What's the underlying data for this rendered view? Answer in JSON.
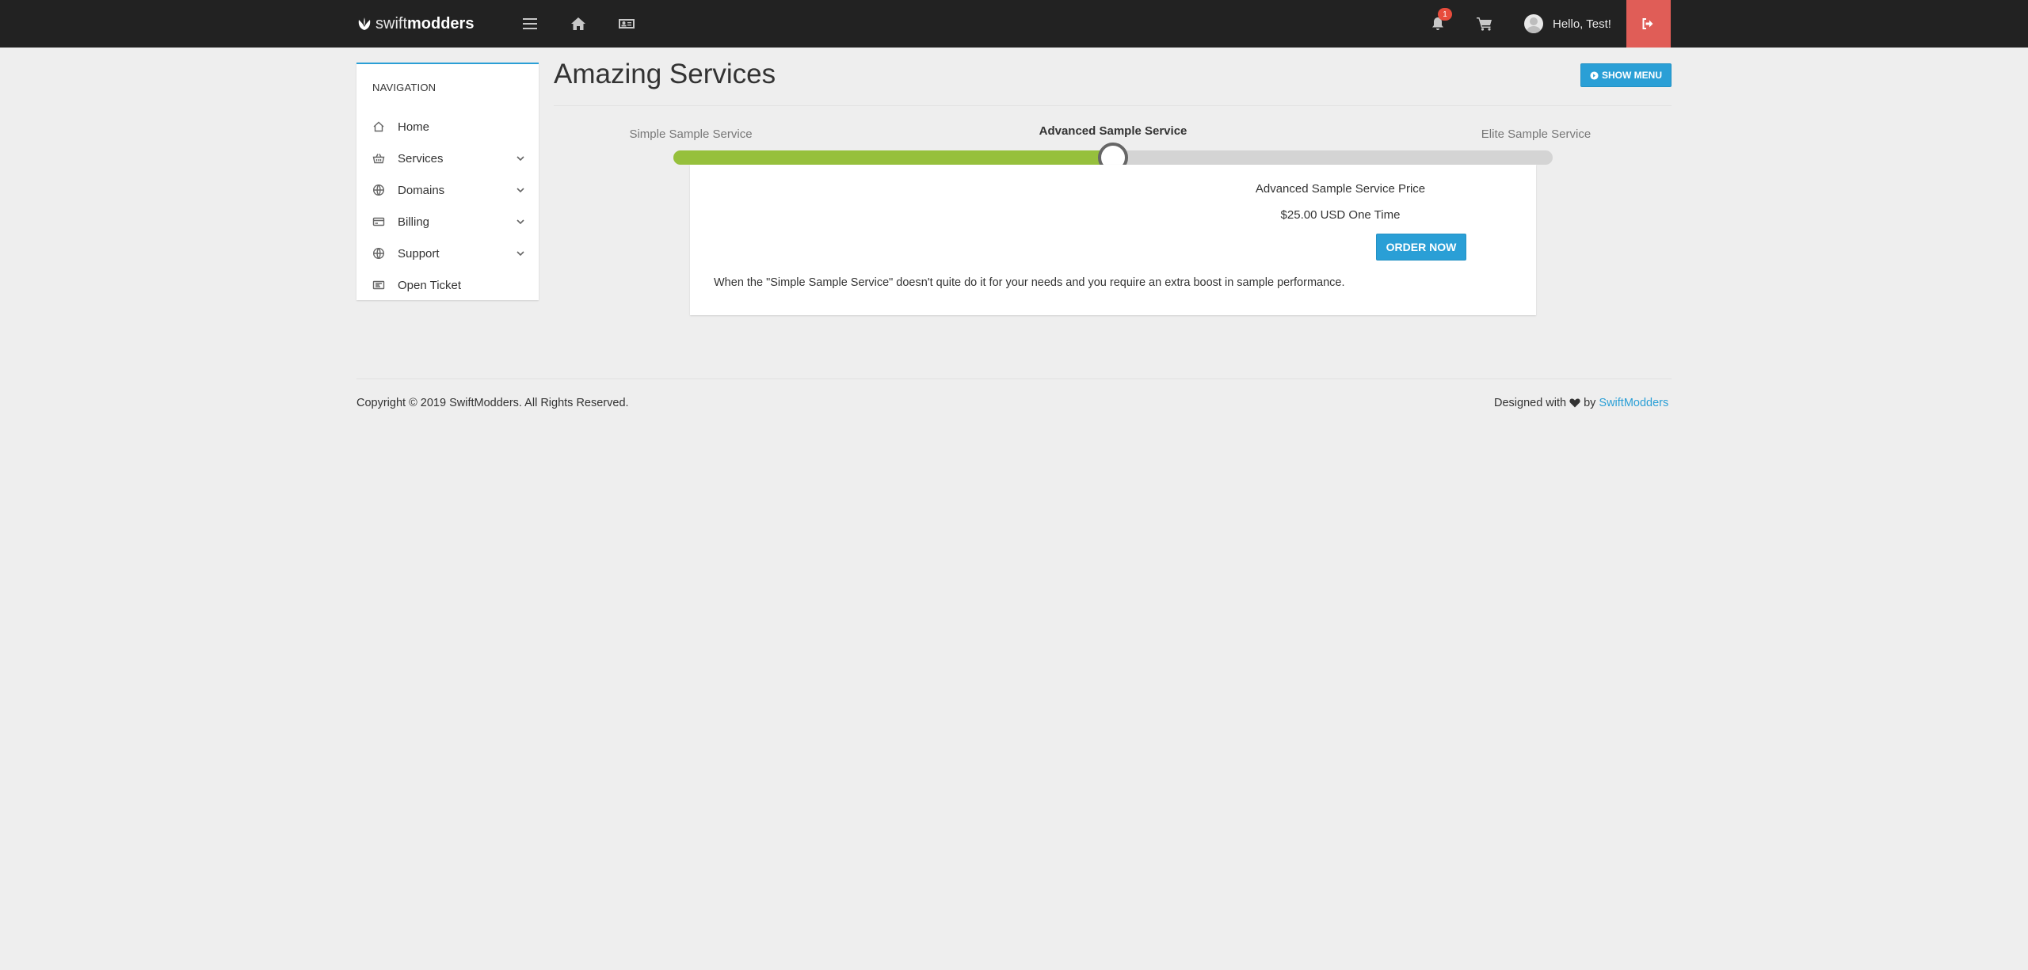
{
  "topbar": {
    "brand_light": "swift",
    "brand_bold": "modders",
    "notification_count": "1",
    "user_greeting": "Hello, Test!"
  },
  "sidebar": {
    "title": "NAVIGATION",
    "items": [
      {
        "label": "Home",
        "icon": "home-icon",
        "has_children": false
      },
      {
        "label": "Services",
        "icon": "basket-icon",
        "has_children": true
      },
      {
        "label": "Domains",
        "icon": "globe-icon",
        "has_children": true
      },
      {
        "label": "Billing",
        "icon": "credit-card-icon",
        "has_children": true
      },
      {
        "label": "Support",
        "icon": "globe-icon",
        "has_children": true
      },
      {
        "label": "Open Ticket",
        "icon": "ticket-icon",
        "has_children": false
      }
    ]
  },
  "main": {
    "title": "Amazing Services",
    "show_menu_label": "SHOW MENU",
    "tiers": [
      "Simple Sample Service",
      "Advanced Sample Service",
      "Elite Sample Service"
    ],
    "selected_tier": 1,
    "slider_fraction": 0.5,
    "price_label": "Advanced Sample Service Price",
    "price_value": "$25.00 USD One Time",
    "order_label": "ORDER NOW",
    "description": "When the \"Simple Sample Service\" doesn't quite do it for your needs and you require an extra boost in sample performance."
  },
  "footer": {
    "copyright": "Copyright © 2019 SwiftModders. All Rights Reserved.",
    "designed_prefix": "Designed with",
    "designed_by": "by",
    "designed_link": "SwiftModders"
  },
  "colors": {
    "navbar": "#222222",
    "accent": "#2a9fd6",
    "slider_fill": "#96c03c",
    "logout": "#e05d57"
  }
}
